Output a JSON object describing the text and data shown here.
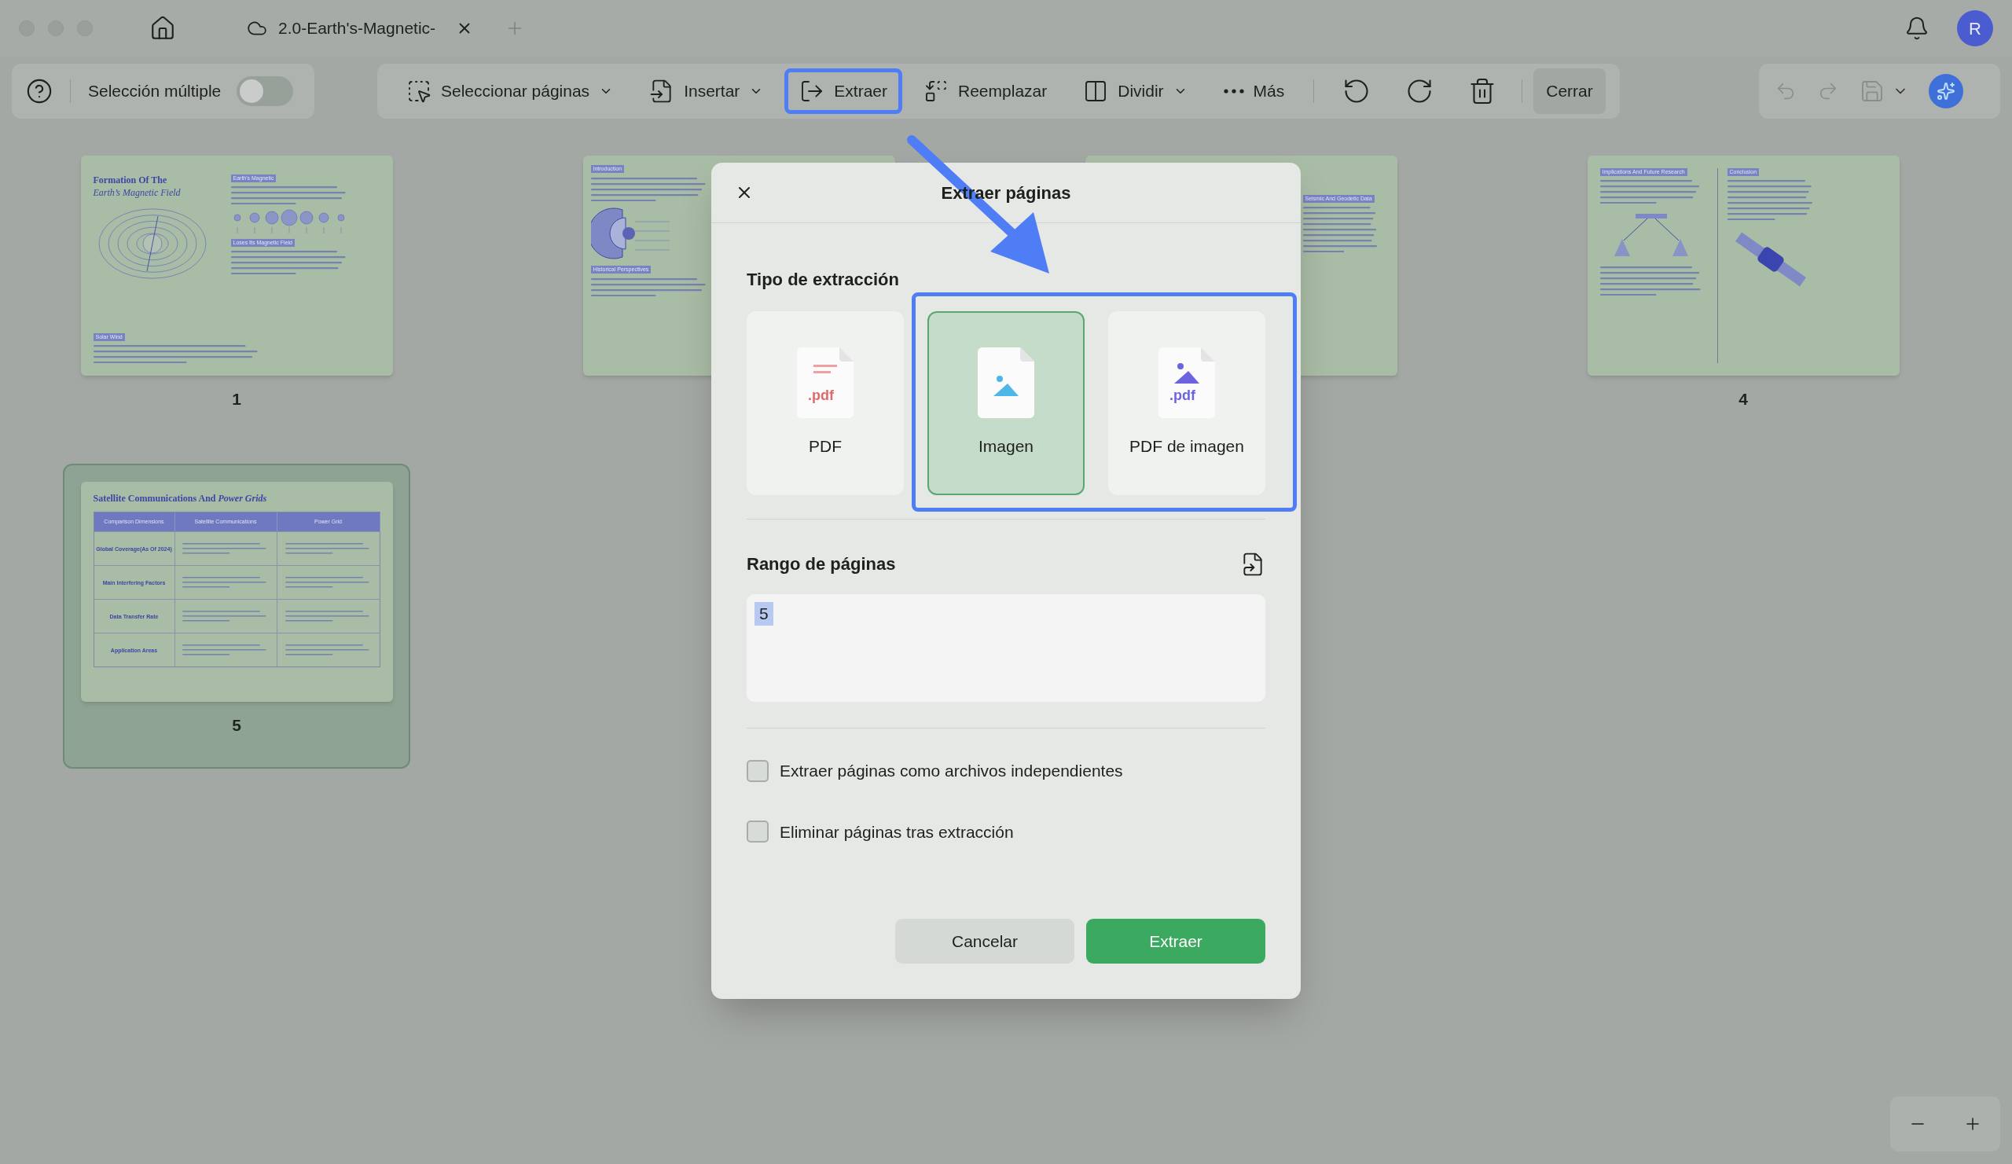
{
  "window": {
    "tab_title": "2.0-Earth's-Magnetic-",
    "avatar": "R"
  },
  "toolbar": {
    "multi_select": {
      "label": "Selección múltiple",
      "on": false
    },
    "items": [
      {
        "label": "Seleccionar páginas",
        "kind": "dropdown",
        "highlighted": false
      },
      {
        "label": "Insertar",
        "kind": "dropdown",
        "highlighted": false
      },
      {
        "label": "Extraer",
        "kind": "button",
        "highlighted": true
      },
      {
        "label": "Reemplazar",
        "kind": "button",
        "highlighted": false
      },
      {
        "label": "Dividir",
        "kind": "dropdown",
        "highlighted": false
      },
      {
        "label": "Más",
        "kind": "button",
        "highlighted": false
      }
    ],
    "close": "Cerrar"
  },
  "pages": [
    {
      "number": "1",
      "kind": "magnetic",
      "selected": false,
      "title": "Formation Of The",
      "subtitle": "Earth’s Magnetic Field",
      "headings": [
        "Earth's Magnetic",
        "Loses Its Magnetic Field",
        "Solar Wind"
      ]
    },
    {
      "kind": "layers",
      "selected": false,
      "headings": [
        "Introduction",
        "Historical Perspectives"
      ]
    },
    {
      "kind": "seismic",
      "selected": false,
      "headings": [
        "Seismic And Geodetic Data"
      ]
    },
    {
      "number": "4",
      "kind": "satellite",
      "selected": false,
      "headings": [
        "Implications And Future Research",
        "Conclusion"
      ]
    },
    {
      "number": "5",
      "kind": "table",
      "selected": true,
      "title": "Satellite Communications And *Power Grids*",
      "columns": [
        "Comparison Dimensions",
        "Satellite Communications",
        "Power Grid"
      ],
      "rows": [
        "Global Coverage(As Of 2024)",
        "Main Interfering Factors",
        "Data Transfer Rate",
        "Application Areas"
      ]
    }
  ],
  "dialog": {
    "title": "Extraer páginas",
    "type_label": "Tipo de extracción",
    "options_highlighted": true,
    "options": [
      {
        "label": "PDF",
        "kind": "pdf",
        "selected": false,
        "badge": ".pdf"
      },
      {
        "label": "Imagen",
        "kind": "image",
        "selected": true
      },
      {
        "label": "PDF de imagen",
        "kind": "image_pdf",
        "selected": false,
        "badge": ".pdf"
      }
    ],
    "range_label": "Rango de páginas",
    "range_value": "5",
    "range_value_selected": true,
    "checkboxes": [
      {
        "label": "Extraer páginas como archivos independientes",
        "checked": false
      },
      {
        "label": "Eliminar páginas tras extracción",
        "checked": false
      }
    ],
    "cancel": "Cancelar",
    "confirm": "Extraer"
  }
}
